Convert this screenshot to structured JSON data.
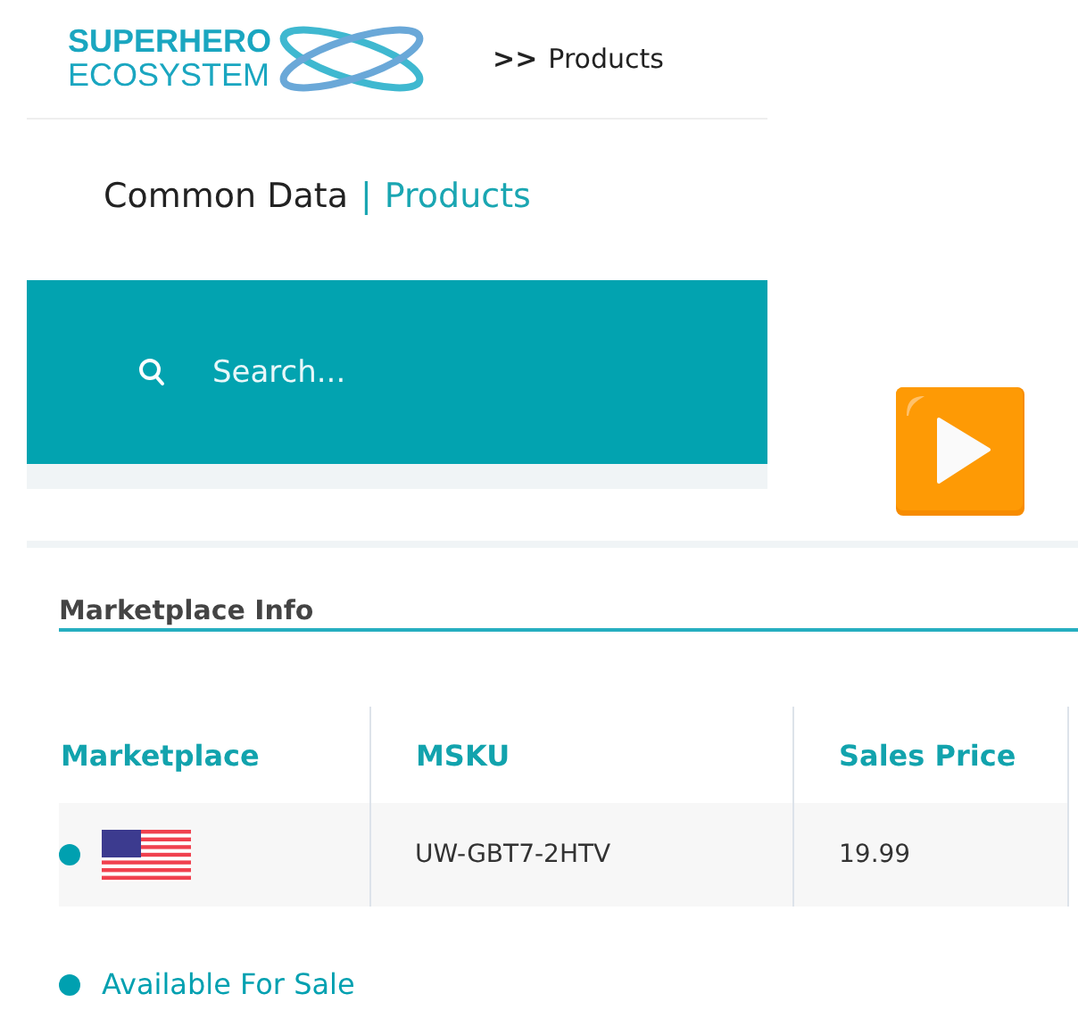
{
  "logo": {
    "line_1": "SUPERHERO",
    "line_2": "ECOSYSTEM"
  },
  "breadcrumb": {
    "separator": ">>",
    "current": "Products"
  },
  "page_title": {
    "section": "Common Data",
    "separator": "|",
    "page": "Products"
  },
  "search": {
    "placeholder": "Search..."
  },
  "panel": {
    "title": "Marketplace Info"
  },
  "table": {
    "columns": [
      "Marketplace",
      "MSKU",
      "Sales Price"
    ],
    "rows": [
      {
        "color": "#00a0b0",
        "msku": "UW-GBT7-2HTV",
        "sales_price": "19.99"
      }
    ]
  },
  "legend": [
    {
      "label": "Available For Sale",
      "color": "#00a0b0"
    }
  ]
}
